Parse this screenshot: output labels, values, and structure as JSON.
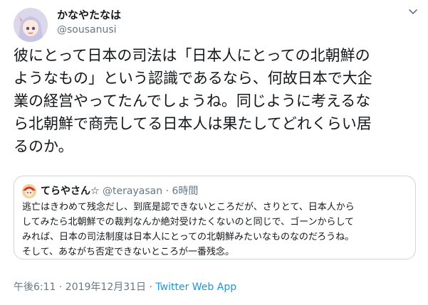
{
  "author": {
    "display_name": "かなやたなは",
    "handle": "@sousanusi"
  },
  "tweet": {
    "text": "彼にとって日本の司法は「日本人にとっての北朝鮮の\nようなもの」という認識であるなら、何故日本で大企\n業の経営やってたんでしょうね。同じように考えるな\nら北朝鮮で商売してる日本人は果たしてどれくらい居\nるのか。"
  },
  "quoted_tweet": {
    "display_name": "てらやさん☆",
    "handle": "@terayasan",
    "separator": "·",
    "time": "6時間",
    "text": "逃亡はきわめて残念だし、到底是認できないところだが、さりとて、日本人から\nしてみたら北朝鮮での裁判なんか絶対受けたくないのと同じで、ゴーンからして\nみれば、日本の司法制度は日本人にとっての北朝鮮みたいなものなのだろうね。\nそして、あながち否定できないところが一番残念。"
  },
  "footer": {
    "timestamp": "午後6:11 · 2019年12月31日 · ",
    "source": "Twitter Web App"
  },
  "colors": {
    "text": "#14171a",
    "secondary": "#657786",
    "link": "#1b95e0",
    "border": "#ccd6dd"
  },
  "icons": {
    "menu": "chevron-down-icon"
  }
}
